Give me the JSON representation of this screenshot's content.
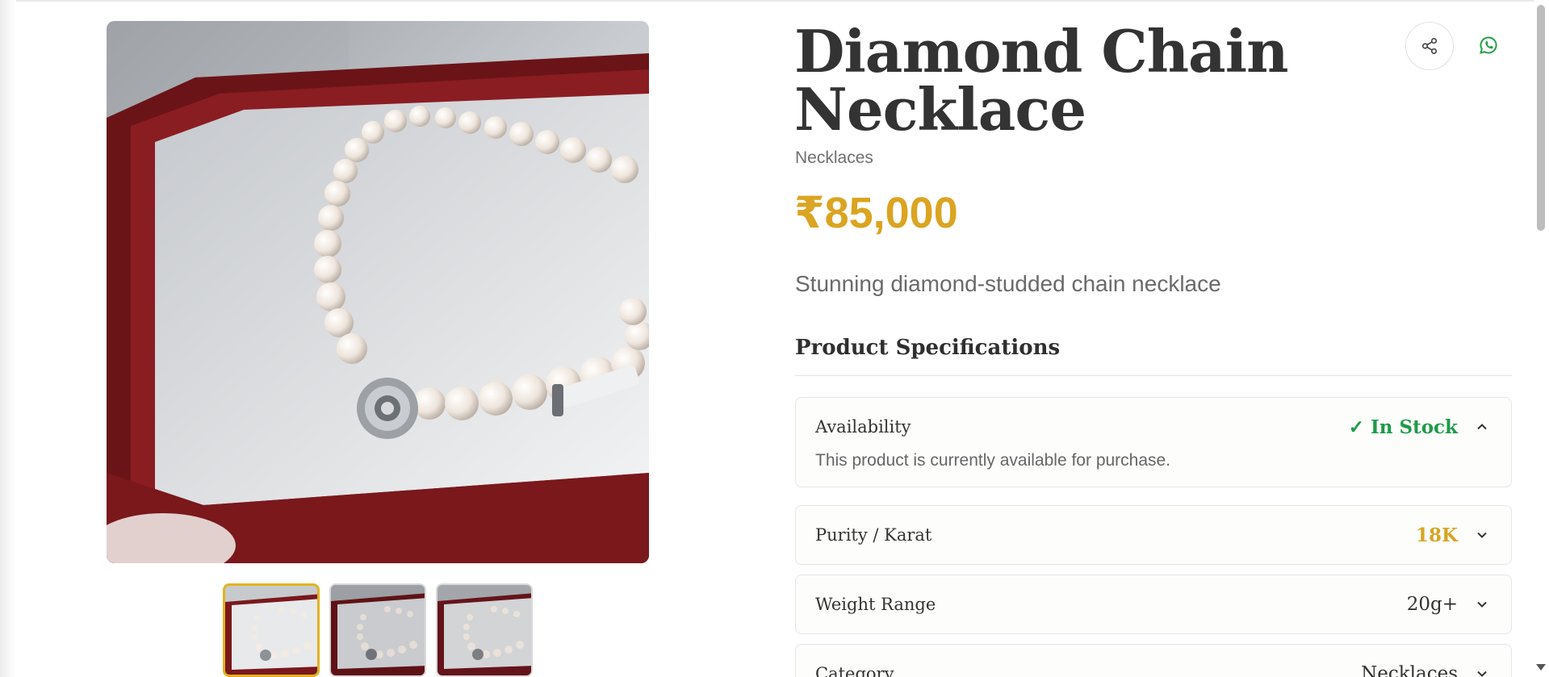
{
  "product": {
    "title": "Diamond Chain Necklace",
    "category": "Necklaces",
    "price": "₹85,000",
    "description": "Stunning diamond-studded chain necklace"
  },
  "actions": {
    "share_icon": "share-icon",
    "whatsapp_icon": "whatsapp-icon"
  },
  "gallery": {
    "main_image": "pearl-necklace-in-box",
    "thumbnails": [
      "pearl-necklace-thumb-1",
      "pearl-necklace-thumb-2",
      "pearl-necklace-thumb-3"
    ],
    "active_index": 0
  },
  "specs": {
    "heading": "Product Specifications",
    "items": [
      {
        "label": "Availability",
        "value": "✓ In Stock",
        "detail": "This product is currently available for purchase.",
        "expanded": true,
        "color": "#1f9a4a"
      },
      {
        "label": "Purity / Karat",
        "value": "18K",
        "expanded": false,
        "color": "#d7a524"
      },
      {
        "label": "Weight Range",
        "value": "20g+",
        "expanded": false,
        "color": "#333333"
      },
      {
        "label": "Category",
        "value": "Necklaces",
        "expanded": false,
        "color": "#333333"
      }
    ]
  },
  "colors": {
    "price": "#dba421",
    "accent_gold": "#e3b21f",
    "in_stock": "#1f9a4a",
    "whatsapp": "#25a244"
  }
}
